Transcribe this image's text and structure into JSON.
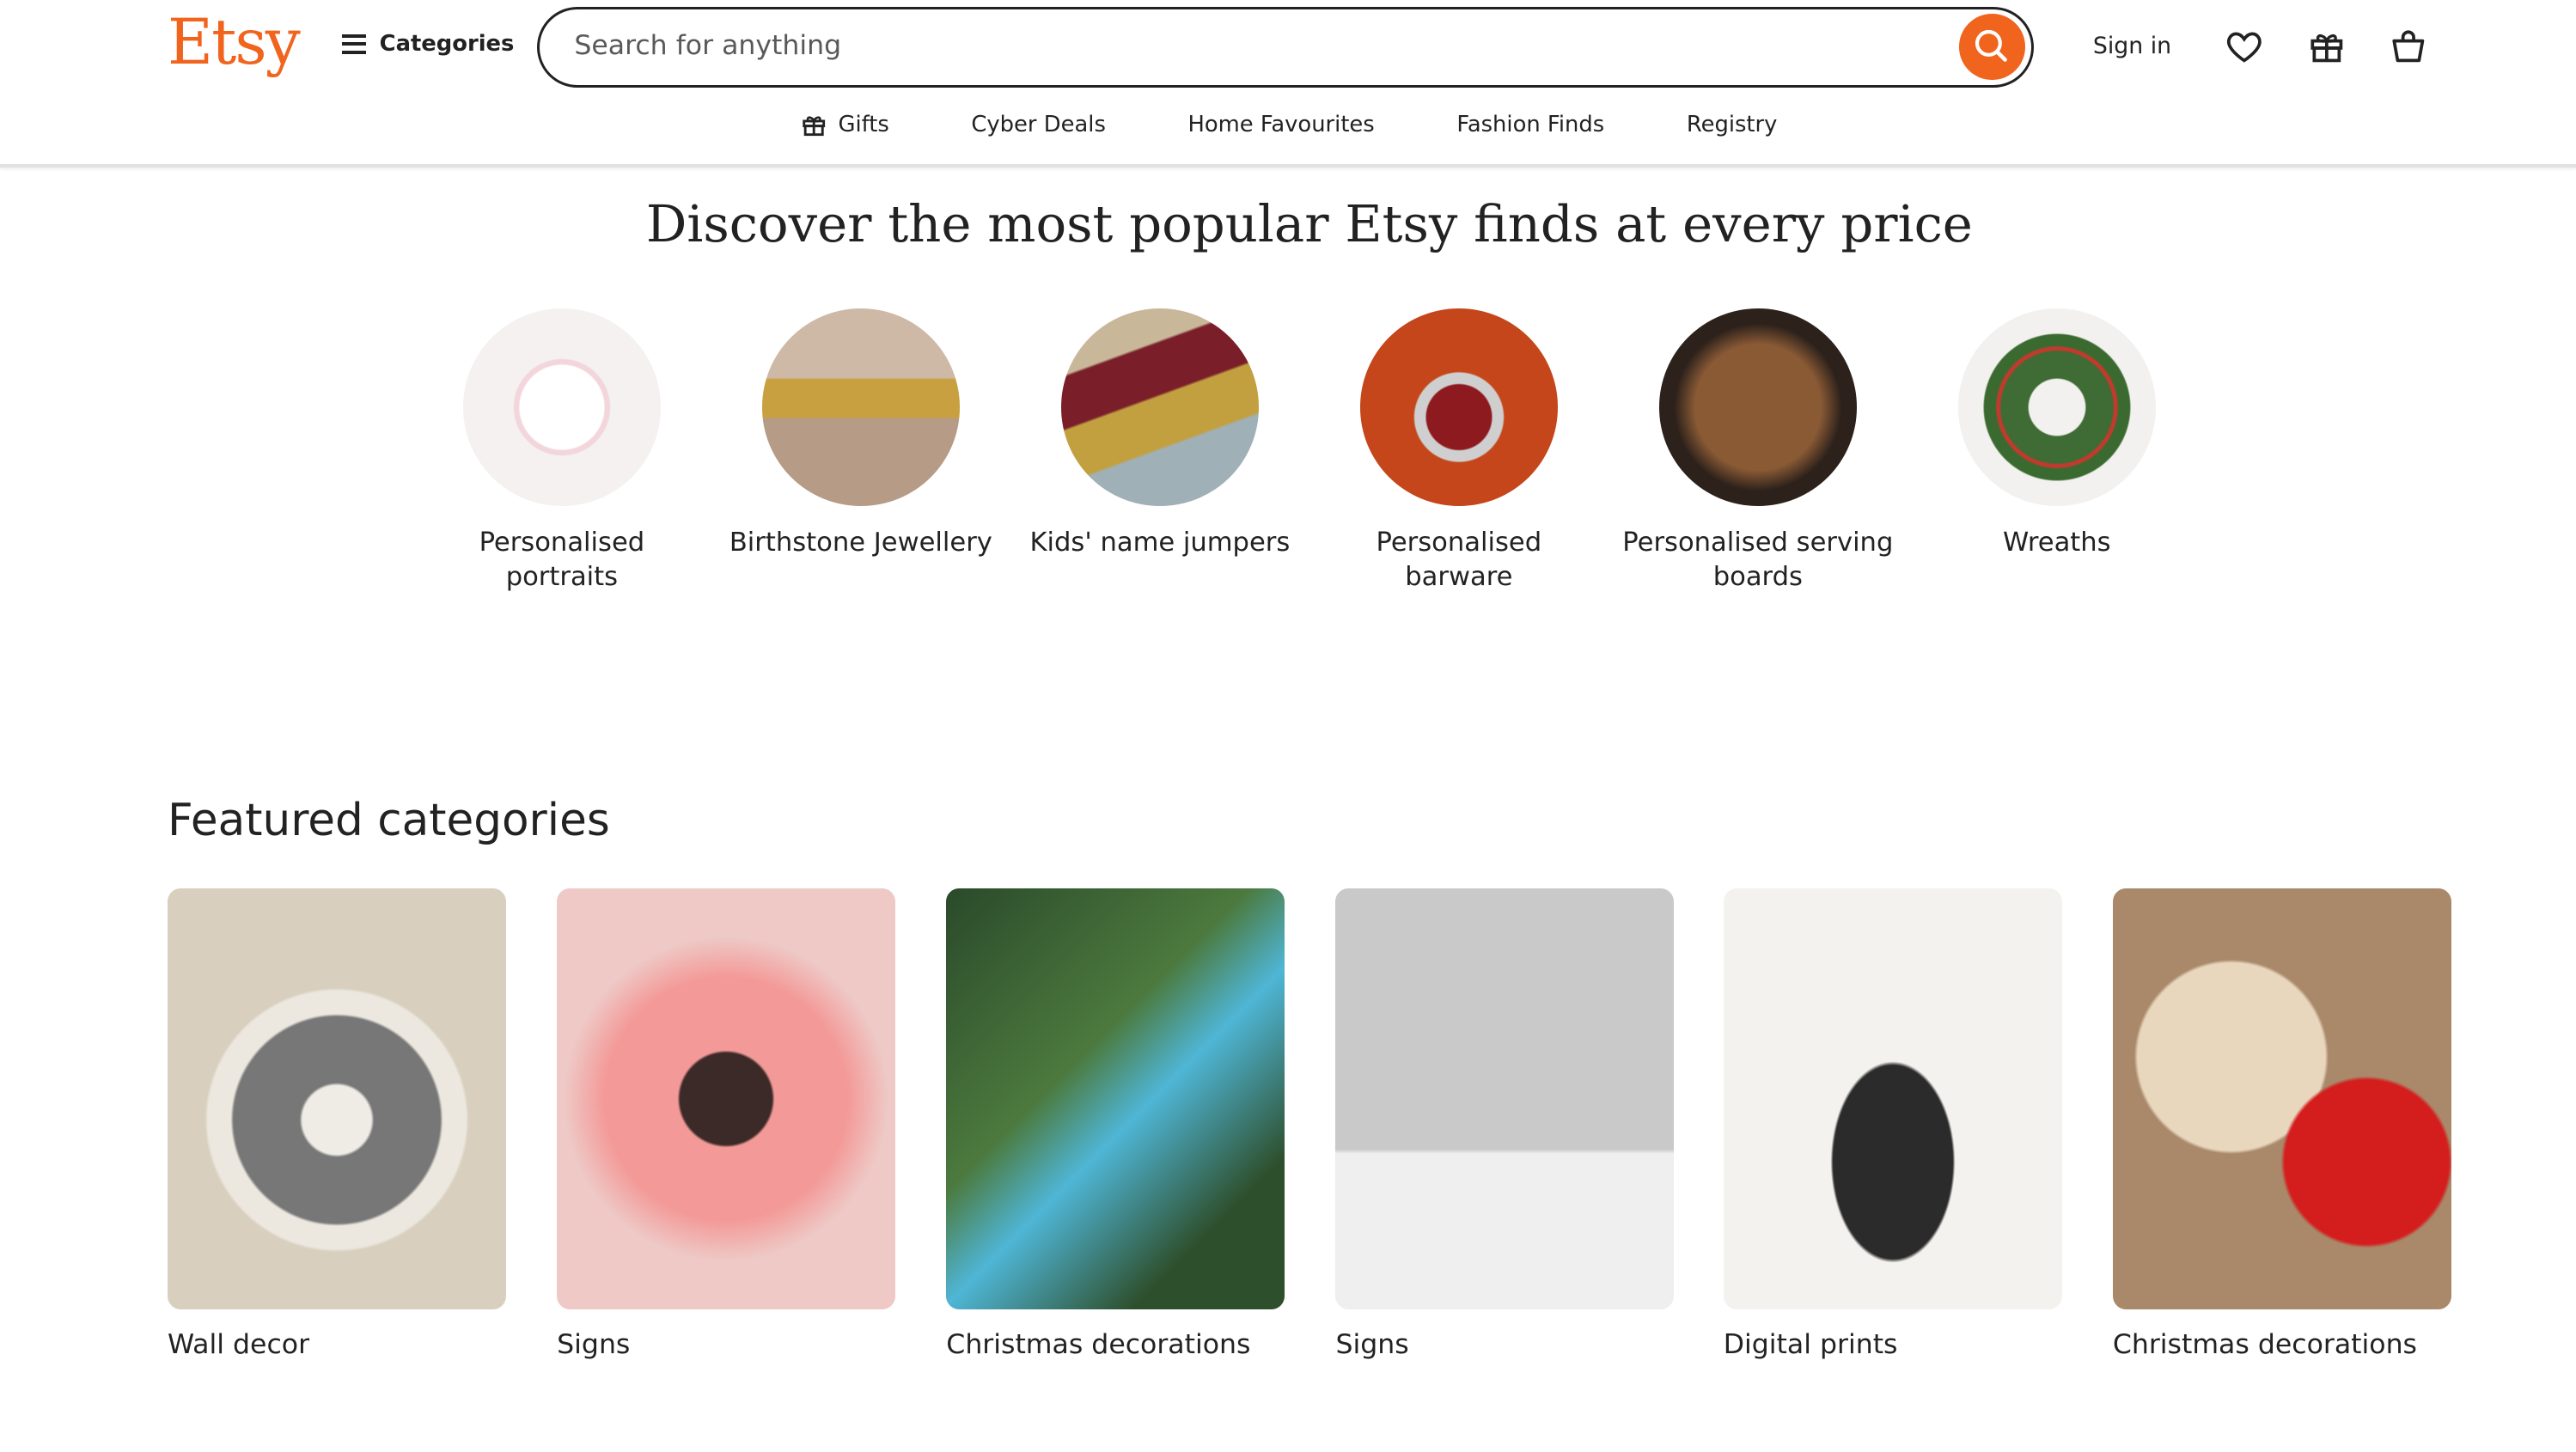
{
  "header": {
    "logo": "Etsy",
    "categories_label": "Categories",
    "search_placeholder": "Search for anything",
    "sign_in": "Sign in"
  },
  "nav": [
    "Gifts",
    "Cyber Deals",
    "Home Favourites",
    "Fashion Finds",
    "Registry"
  ],
  "hero_title": "Discover the most popular Etsy finds at every price",
  "popular": [
    {
      "label": "Personalised portraits"
    },
    {
      "label": "Birthstone Jewellery"
    },
    {
      "label": "Kids' name jumpers"
    },
    {
      "label": "Personalised barware"
    },
    {
      "label": "Personalised serving boards"
    },
    {
      "label": "Wreaths"
    }
  ],
  "featured_title": "Featured categories",
  "featured": [
    {
      "label": "Wall decor"
    },
    {
      "label": "Signs"
    },
    {
      "label": "Christmas decorations"
    },
    {
      "label": "Signs"
    },
    {
      "label": "Digital prints"
    },
    {
      "label": "Christmas decorations"
    }
  ],
  "colors": {
    "brand": "#F1641E",
    "text": "#222222"
  }
}
